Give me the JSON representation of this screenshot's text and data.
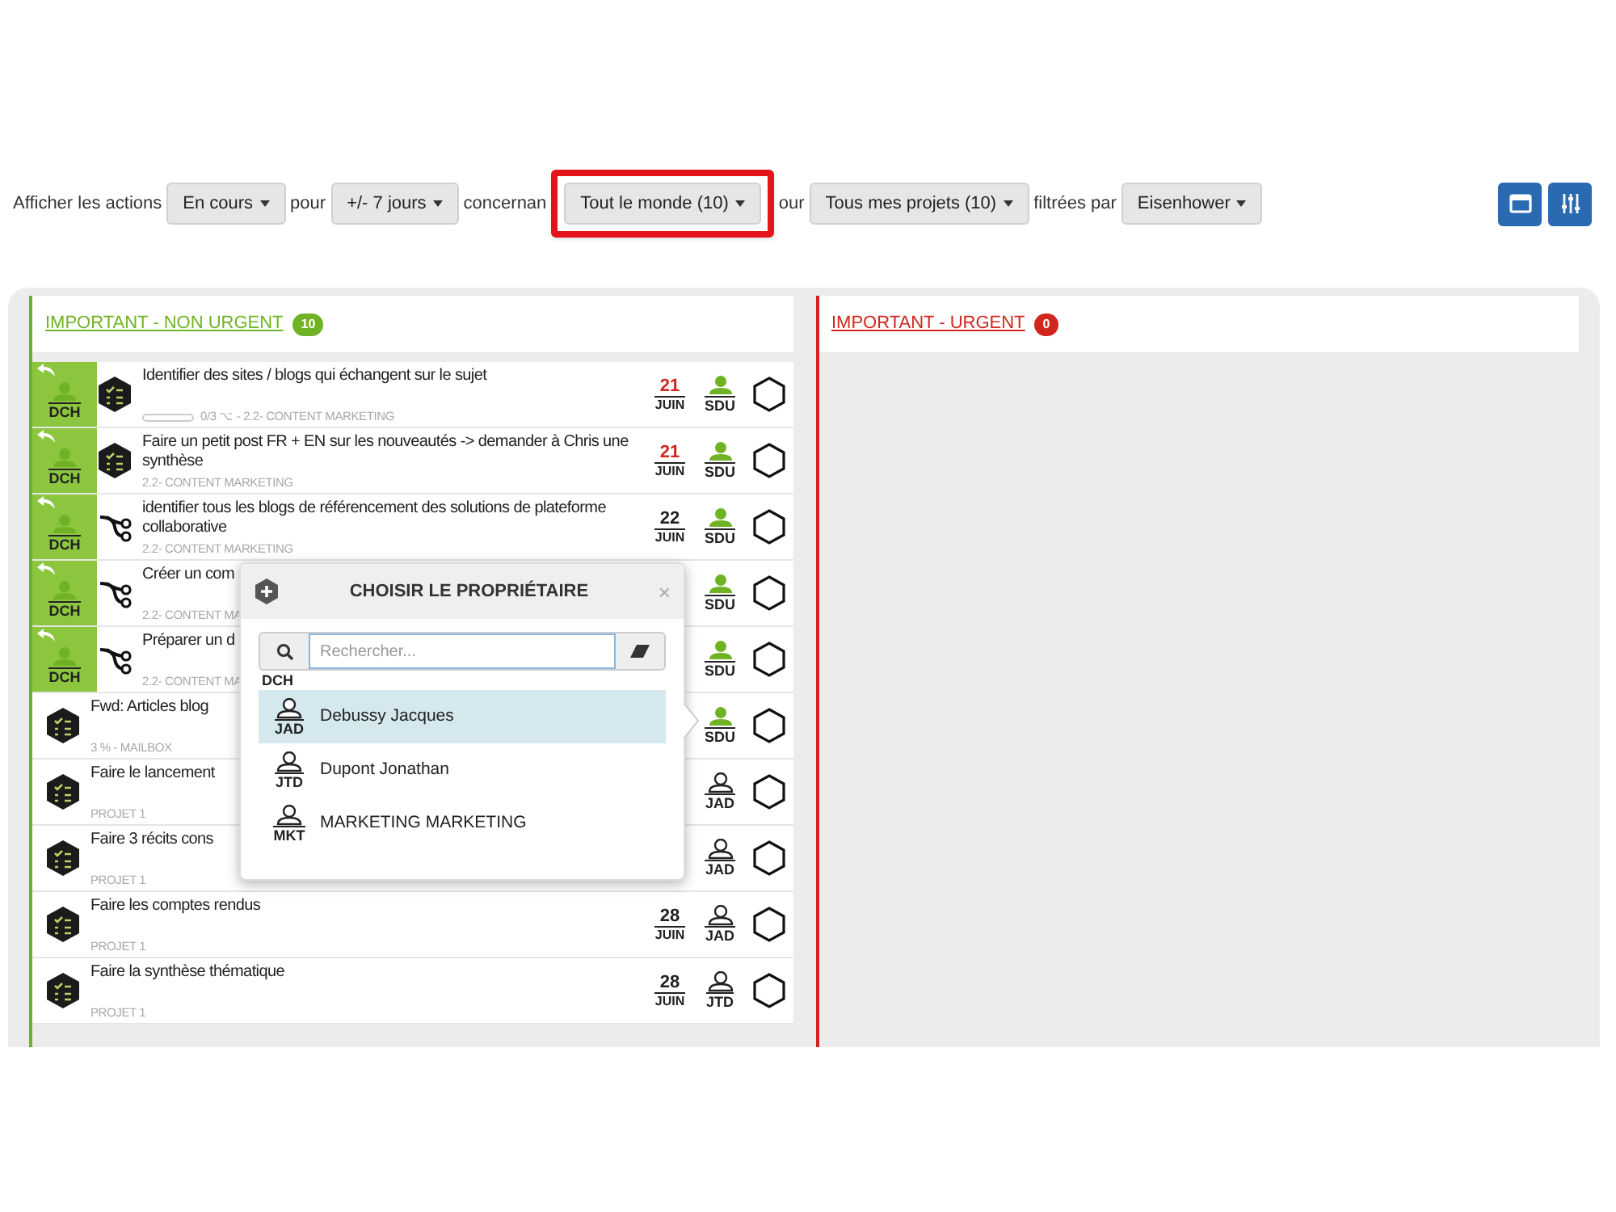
{
  "filters": [
    {
      "kind": "label",
      "text": "Afficher les actions"
    },
    {
      "kind": "dropdown",
      "text": "En cours",
      "highlighted": false
    },
    {
      "kind": "label",
      "text": "pour"
    },
    {
      "kind": "dropdown",
      "text": "+/- 7 jours",
      "highlighted": false
    },
    {
      "kind": "label",
      "text": "concernan"
    },
    {
      "kind": "dropdown",
      "text": "Tout le monde (10)",
      "highlighted": true
    },
    {
      "kind": "label",
      "text": "our"
    },
    {
      "kind": "dropdown",
      "text": "Tous mes projets (10)",
      "highlighted": false
    },
    {
      "kind": "label",
      "text": "filtrées par"
    },
    {
      "kind": "dropdown",
      "text": "Eisenhower",
      "highlighted": false
    }
  ],
  "columns": [
    {
      "title": "IMPORTANT - NON URGENT",
      "count": "10",
      "color": "#6fb324",
      "tasks": [
        {
          "title": "Identifier des sites / blogs qui échangent sur le sujet",
          "progress": {
            "level": 0
          },
          "meta": "0/3 ⌥ - 2.2- CONTENT MARKETING",
          "delegate": "DCH",
          "kind": "checklist",
          "date": {
            "day": "21",
            "month": "JUIN",
            "overdue": true
          },
          "owner": {
            "initials": "SDU",
            "active": true
          },
          "done": false
        },
        {
          "title": "Faire un petit post FR + EN sur les nouveautés -> demander à Chris une synthèse",
          "meta": "2.2- CONTENT MARKETING",
          "delegate": "DCH",
          "kind": "checklist",
          "date": {
            "day": "21",
            "month": "JUIN",
            "overdue": true
          },
          "owner": {
            "initials": "SDU",
            "active": true
          },
          "done": false
        },
        {
          "title": "identifier tous les blogs de référencement des solutions de plateforme collaborative",
          "meta": "2.2- CONTENT MARKETING",
          "delegate": "DCH",
          "kind": "branch",
          "date": {
            "day": "22",
            "month": "JUIN",
            "overdue": false
          },
          "owner": {
            "initials": "SDU",
            "active": true
          },
          "done": false
        },
        {
          "title": "Créer un com",
          "meta": "2.2- CONTENT MA",
          "delegate": "DCH",
          "kind": "branch",
          "owner": {
            "initials": "SDU",
            "active": true
          },
          "done": false
        },
        {
          "title": "Préparer un d",
          "meta": "2.2- CONTENT MA",
          "delegate": "DCH",
          "kind": "branch",
          "owner": {
            "initials": "SDU",
            "active": true
          },
          "done": false
        },
        {
          "title": "Fwd: Articles blog",
          "meta": "3 % - MAILBOX",
          "kind": "checklist",
          "owner": {
            "initials": "SDU",
            "active": true
          },
          "done": false
        },
        {
          "title": "Faire le lancement",
          "meta": "PROJET 1",
          "kind": "checklist",
          "owner": {
            "initials": "JAD",
            "active": false
          },
          "done": false
        },
        {
          "title": "Faire 3 récits cons",
          "meta": "PROJET 1",
          "kind": "checklist",
          "owner": {
            "initials": "JAD",
            "active": false
          },
          "done": false
        },
        {
          "title": "Faire les comptes rendus",
          "meta": "PROJET 1",
          "kind": "checklist",
          "date": {
            "day": "28",
            "month": "JUIN",
            "overdue": false
          },
          "owner": {
            "initials": "JAD",
            "active": false
          },
          "done": false
        },
        {
          "title": "Faire la synthèse thématique",
          "meta": "PROJET 1",
          "kind": "checklist",
          "date": {
            "day": "28",
            "month": "JUIN",
            "overdue": false
          },
          "owner": {
            "initials": "JTD",
            "active": false
          },
          "done": false
        }
      ]
    },
    {
      "title": "IMPORTANT - URGENT",
      "count": "0",
      "color": "#d0261d"
    }
  ],
  "popover": {
    "title": "CHOISIR LE PROPRIÉTAIRE",
    "close": "×",
    "search": {
      "placeholder": "Rechercher..."
    },
    "hidden_item": {
      "initials": "DCH"
    },
    "items": [
      {
        "initials": "JAD",
        "name": "Debussy Jacques",
        "selected": true
      },
      {
        "initials": "JTD",
        "name": "Dupont Jonathan",
        "selected": false
      },
      {
        "initials": "MKT",
        "name": "MARKETING MARKETING",
        "selected": false
      }
    ]
  }
}
